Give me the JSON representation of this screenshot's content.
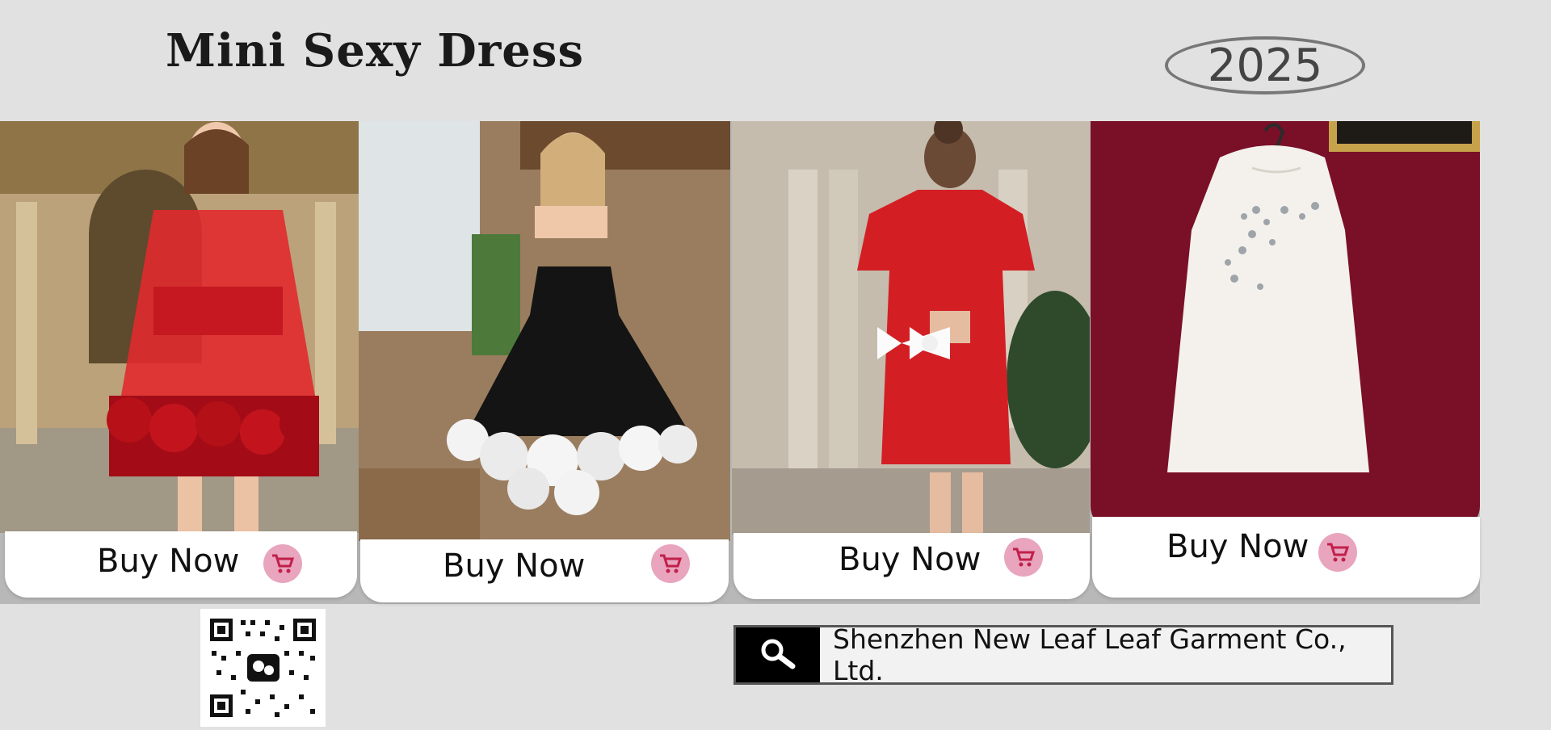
{
  "header": {
    "title": "Mini Sexy Dress",
    "year": "2025"
  },
  "products": [
    {
      "buy_label": "Buy Now",
      "image_desc": "red-sheer-rose-dress"
    },
    {
      "buy_label": "Buy Now",
      "image_desc": "black-strapless-white-flower-dress"
    },
    {
      "buy_label": "Buy Now",
      "image_desc": "red-bow-back-dress"
    },
    {
      "buy_label": "Buy Now",
      "image_desc": "white-embellished-dress"
    }
  ],
  "footer": {
    "company": "Shenzhen New Leaf Leaf Garment Co., Ltd."
  },
  "colors": {
    "background": "#e1e1e1",
    "cart_badge": "#e8a5bd",
    "accent_red": "#d41f25",
    "burgundy": "#7a1027"
  },
  "icons": {
    "cart": "shopping-cart-icon",
    "search": "search-icon",
    "qr": "qr-code-icon"
  }
}
